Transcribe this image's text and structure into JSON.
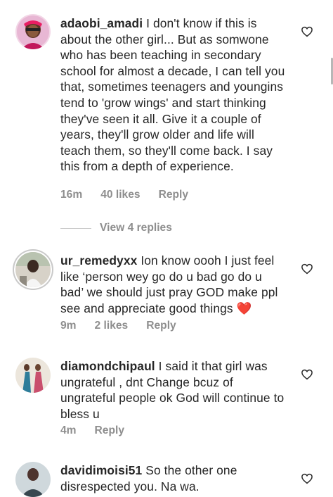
{
  "comments": [
    {
      "username": "adaobi_amadi",
      "text": "I don't know if this is about the other girl... But as somwone who has been teaching in secondary school for almost a decade, I can tell you that, sometimes teenagers and youngins tend to 'grow wings' and start thinking they've seen it all. Give it a couple of years, they'll grow older and life will teach them, so they'll come back. I say this from a depth of experience.",
      "time": "16m",
      "likes": "40 likes",
      "reply": "Reply",
      "view_replies": "View 4 replies"
    },
    {
      "username": "ur_remedyxx",
      "text": "Ion know oooh I just feel like ‘person wey go do u bad go do u bad’ we should just pray GOD make ppl see and appreciate good things ❤️",
      "time": "9m",
      "likes": "2 likes",
      "reply": "Reply"
    },
    {
      "username": "diamondchipaul",
      "text": "I said it that girl was ungrateful , dnt Change bcuz of ungrateful people ok God will continue to bless u",
      "time": "4m",
      "reply": "Reply"
    },
    {
      "username": "davidimoisi51",
      "text": "So the other one disrespected you. Na wa."
    }
  ]
}
